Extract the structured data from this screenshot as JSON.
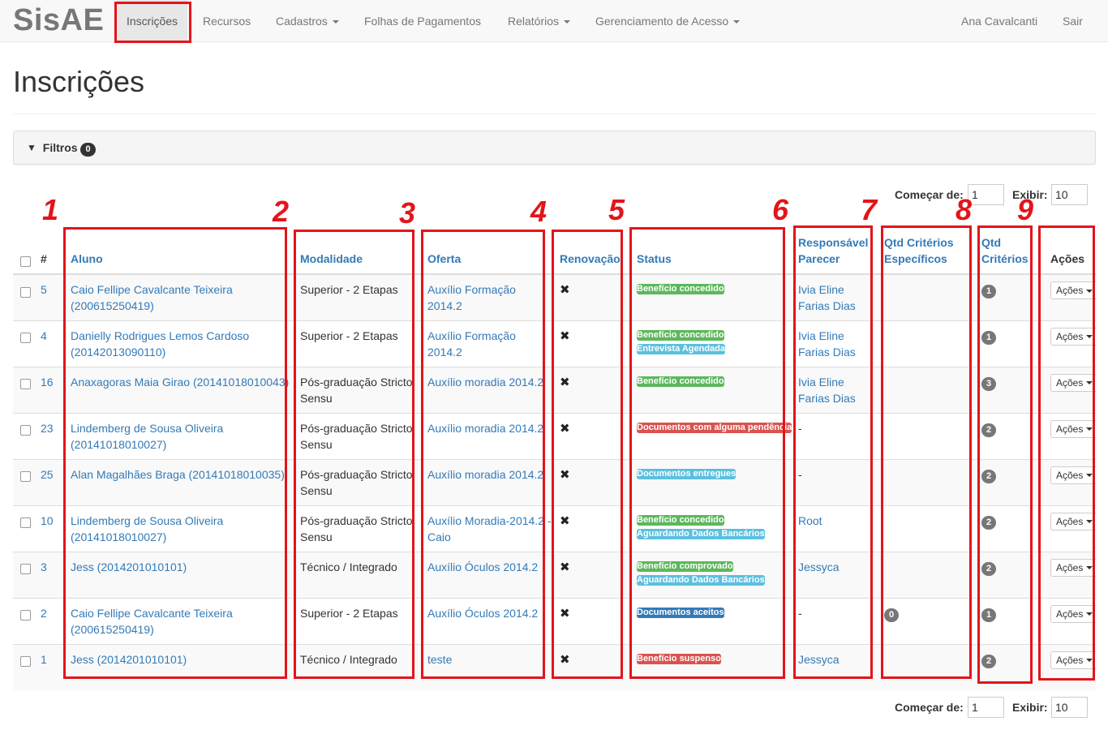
{
  "navbar": {
    "brand": "SisAE",
    "items": [
      {
        "label": "Inscrições",
        "active": true
      },
      {
        "label": "Recursos"
      },
      {
        "label": "Cadastros",
        "dropdown": true
      },
      {
        "label": "Folhas de Pagamentos"
      },
      {
        "label": "Relatórios",
        "dropdown": true
      },
      {
        "label": "Gerenciamento de Acesso",
        "dropdown": true
      }
    ],
    "user": "Ana Cavalcanti",
    "logout": "Sair"
  },
  "page": {
    "title": "Inscrições"
  },
  "filters": {
    "label": "Filtros",
    "count": "0"
  },
  "pagination_top": {
    "start_label": "Começar de:",
    "start_value": "1",
    "show_label": "Exibir:",
    "show_value": "10"
  },
  "pagination_bottom": {
    "start_label": "Começar de:",
    "start_value": "1",
    "show_label": "Exibir:",
    "show_value": "10"
  },
  "table": {
    "headers": {
      "num": "#",
      "aluno": "Aluno",
      "modalidade": "Modalidade",
      "oferta": "Oferta",
      "renovacao": "Renovação",
      "status": "Status",
      "responsavel": "Responsável Parecer",
      "qtd_especificos": "Qtd Critérios Específicos",
      "qtd_criterios": "Qtd Critérios",
      "acoes": "Ações"
    },
    "rows": [
      {
        "num": "5",
        "aluno": "Caio Fellipe Cavalcante Teixeira (200615250419)",
        "modalidade": "Superior - 2 Etapas",
        "oferta": "Auxílio Formação 2014.2",
        "renovacao": "✖",
        "status": [
          {
            "text": "Benefício concedido",
            "kind": "success"
          }
        ],
        "responsavel": "Ivia Eline Farias Dias",
        "responsavel_link": true,
        "qtd_especificos": "",
        "qtd_criterios": "1",
        "acoes": "Ações"
      },
      {
        "num": "4",
        "aluno": "Danielly Rodrigues Lemos Cardoso (20142013090110)",
        "modalidade": "Superior - 2 Etapas",
        "oferta": "Auxílio Formação 2014.2",
        "renovacao": "✖",
        "status": [
          {
            "text": "Benefício concedido",
            "kind": "success"
          },
          {
            "text": "Entrevista Agendada",
            "kind": "info"
          }
        ],
        "responsavel": "Ivia Eline Farias Dias",
        "responsavel_link": true,
        "qtd_especificos": "",
        "qtd_criterios": "1",
        "acoes": "Ações"
      },
      {
        "num": "16",
        "aluno": "Anaxagoras Maia Girao (20141018010043)",
        "modalidade": "Pós-graduação Stricto Sensu",
        "oferta": "Auxílio moradia 2014.2",
        "renovacao": "✖",
        "status": [
          {
            "text": "Benefício concedido",
            "kind": "success"
          }
        ],
        "responsavel": "Ivia Eline Farias Dias",
        "responsavel_link": true,
        "qtd_especificos": "",
        "qtd_criterios": "3",
        "acoes": "Ações"
      },
      {
        "num": "23",
        "aluno": "Lindemberg de Sousa Oliveira (20141018010027)",
        "modalidade": "Pós-graduação Stricto Sensu",
        "oferta": "Auxílio moradia 2014.2",
        "renovacao": "✖",
        "status": [
          {
            "text": "Documentos com alguma pendência",
            "kind": "danger"
          }
        ],
        "responsavel": "-",
        "responsavel_link": false,
        "qtd_especificos": "",
        "qtd_criterios": "2",
        "acoes": "Ações"
      },
      {
        "num": "25",
        "aluno": "Alan Magalhães Braga (20141018010035)",
        "modalidade": "Pós-graduação Stricto Sensu",
        "oferta": "Auxílio moradia 2014.2",
        "renovacao": "✖",
        "status": [
          {
            "text": "Documentos entregues",
            "kind": "info"
          }
        ],
        "responsavel": "-",
        "responsavel_link": false,
        "qtd_especificos": "",
        "qtd_criterios": "2",
        "acoes": "Ações"
      },
      {
        "num": "10",
        "aluno": "Lindemberg de Sousa Oliveira (20141018010027)",
        "modalidade": "Pós-graduação Stricto Sensu",
        "oferta": "Auxílio Moradia-2014.2 - Caio",
        "renovacao": "✖",
        "status": [
          {
            "text": "Benefício concedido",
            "kind": "success"
          },
          {
            "text": "Aguardando Dados Bancários",
            "kind": "info"
          }
        ],
        "responsavel": "Root",
        "responsavel_link": true,
        "qtd_especificos": "",
        "qtd_criterios": "2",
        "acoes": "Ações"
      },
      {
        "num": "3",
        "aluno": "Jess (2014201010101)",
        "modalidade": "Técnico / Integrado",
        "oferta": "Auxílio Óculos 2014.2",
        "renovacao": "✖",
        "status": [
          {
            "text": "Benefício comprovado",
            "kind": "success"
          },
          {
            "text": "Aguardando Dados Bancários",
            "kind": "info"
          }
        ],
        "responsavel": "Jessyca",
        "responsavel_link": true,
        "qtd_especificos": "",
        "qtd_criterios": "2",
        "acoes": "Ações"
      },
      {
        "num": "2",
        "aluno": "Caio Fellipe Cavalcante Teixeira (200615250419)",
        "modalidade": "Superior - 2 Etapas",
        "oferta": "Auxílio Óculos 2014.2",
        "renovacao": "✖",
        "status": [
          {
            "text": "Documentos aceitos",
            "kind": "primary"
          }
        ],
        "responsavel": "-",
        "responsavel_link": false,
        "qtd_especificos": "0",
        "qtd_criterios": "1",
        "acoes": "Ações"
      },
      {
        "num": "1",
        "aluno": "Jess (2014201010101)",
        "modalidade": "Técnico / Integrado",
        "oferta": "teste",
        "renovacao": "✖",
        "status": [
          {
            "text": "Benefício suspenso",
            "kind": "danger"
          }
        ],
        "responsavel": "Jessyca",
        "responsavel_link": true,
        "qtd_especificos": "",
        "qtd_criterios": "2",
        "acoes": "Ações"
      }
    ]
  },
  "annotations": [
    "1",
    "2",
    "3",
    "4",
    "5",
    "6",
    "7",
    "8",
    "9"
  ],
  "colors": {
    "annotation_red": "#e3141b",
    "link_blue": "#337ab7",
    "success": "#5cb85c",
    "info": "#5bc0de",
    "danger": "#d9534f",
    "primary": "#337ab7"
  }
}
